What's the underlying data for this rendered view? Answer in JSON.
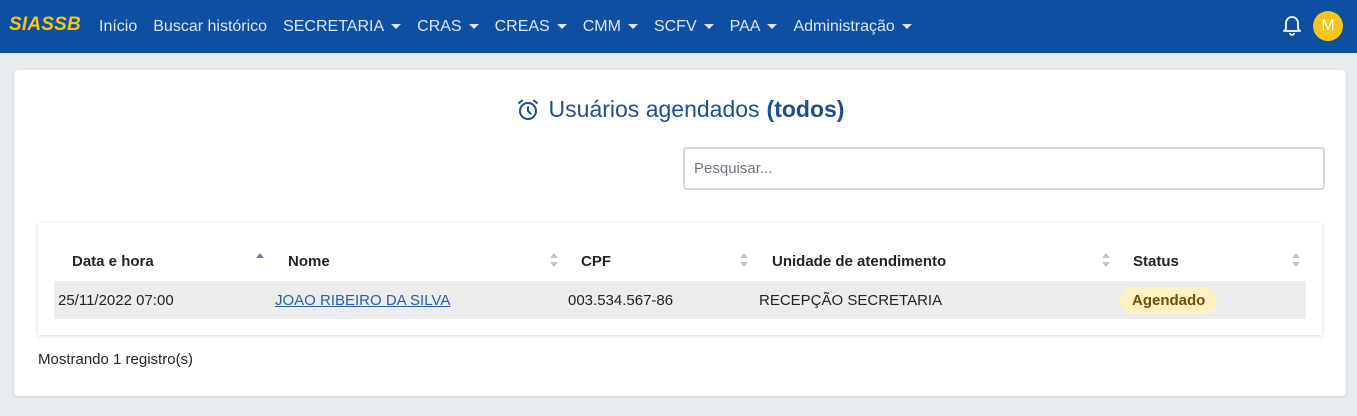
{
  "navbar": {
    "brand": "SIASSB",
    "items": [
      {
        "label": "Início",
        "dropdown": false
      },
      {
        "label": "Buscar histórico",
        "dropdown": false
      },
      {
        "label": "SECRETARIA",
        "dropdown": true
      },
      {
        "label": "CRAS",
        "dropdown": true
      },
      {
        "label": "CREAS",
        "dropdown": true
      },
      {
        "label": "CMM",
        "dropdown": true
      },
      {
        "label": "SCFV",
        "dropdown": true
      },
      {
        "label": "PAA",
        "dropdown": true
      },
      {
        "label": "Administração",
        "dropdown": true
      }
    ],
    "notification_icon": "bell-icon",
    "avatar_initial": "M"
  },
  "page": {
    "title_icon": "alarm-clock-icon",
    "title": "Usuários agendados",
    "title_filter": "(todos)",
    "search_placeholder": "Pesquisar..."
  },
  "table": {
    "columns": [
      "Data e hora",
      "Nome",
      "CPF",
      "Unidade de atendimento",
      "Status"
    ],
    "sorted_column": "Data e hora",
    "sort_direction": "ascending",
    "rows": [
      {
        "datetime": "25/11/2022 07:00",
        "name": "JOAO RIBEIRO DA SILVA",
        "cpf": "003.534.567-86",
        "unit": "RECEPÇÃO SECRETARIA",
        "status": "Agendado"
      }
    ]
  },
  "footer": {
    "records_text": "Mostrando 1 registro(s)"
  },
  "colors": {
    "navbar": "#0d4fa0",
    "brand": "#f5c518",
    "title": "#1f4e8c",
    "status_badge_bg": "#fdf1c1"
  }
}
